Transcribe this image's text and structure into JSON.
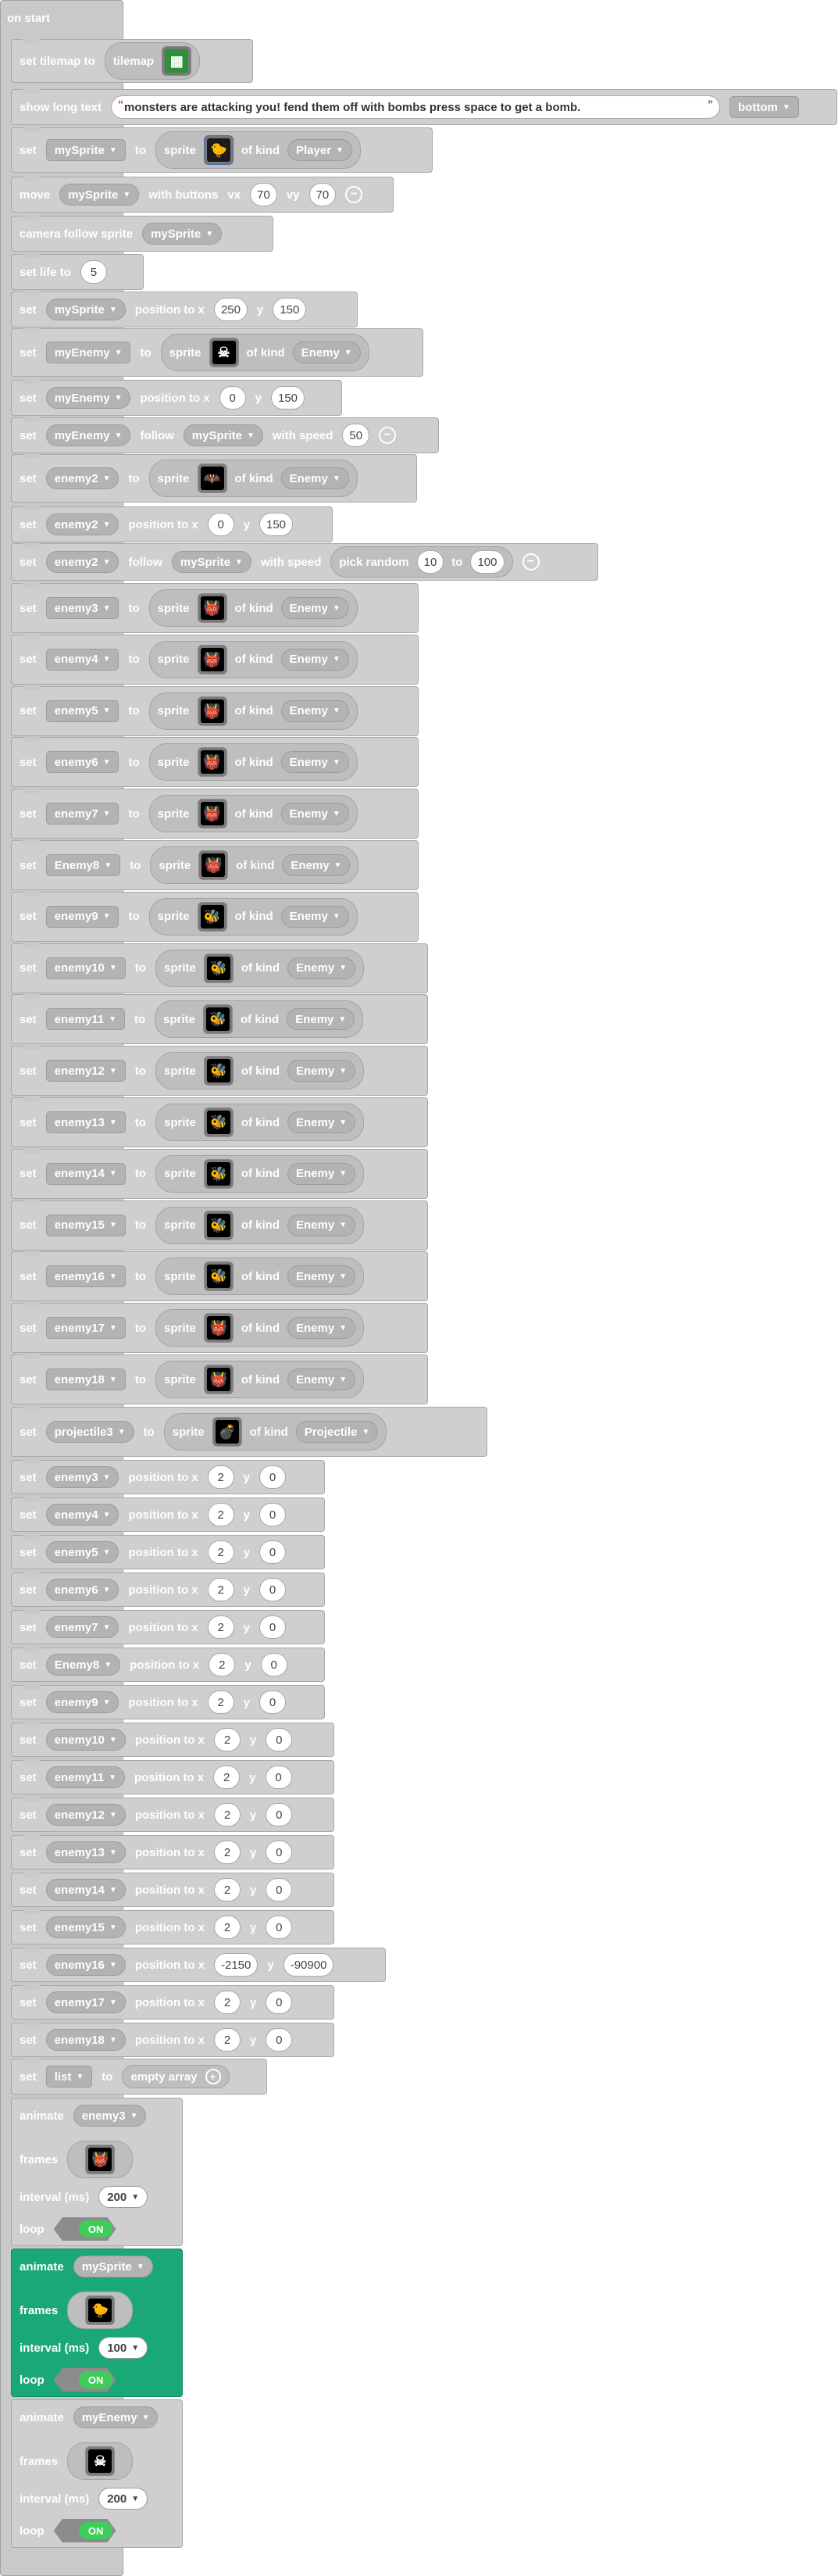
{
  "on_start": "on start",
  "labels": {
    "set": "set",
    "to": "to",
    "sprite": "sprite",
    "of_kind": "of kind",
    "position_to_x": "position to x",
    "y": "y",
    "follow": "follow",
    "with_speed": "with speed",
    "pick_random": "pick random",
    "move": "move",
    "with_buttons": "with buttons",
    "vx": "vx",
    "vy": "vy",
    "camera_follow_sprite": "camera follow sprite",
    "set_life_to": "set life to",
    "set_tilemap_to": "set tilemap to",
    "tilemap": "tilemap",
    "show_long_text": "show long text",
    "empty_array": "empty array",
    "animate": "animate",
    "frames": "frames",
    "interval_ms": "interval (ms)",
    "loop": "loop",
    "on": "ON"
  },
  "long_text": {
    "value": "monsters are attacking you! fend them off with bombs press space to get a bomb.",
    "position": "bottom"
  },
  "player": {
    "var": "mySprite",
    "kind": "Player",
    "vx": "70",
    "vy": "70",
    "camera": "mySprite",
    "life": "5",
    "x": "250",
    "y": "150"
  },
  "my_enemy": {
    "var": "myEnemy",
    "kind": "Enemy",
    "x": "0",
    "y": "150",
    "follow": "mySprite",
    "speed": "50"
  },
  "enemy2": {
    "var": "enemy2",
    "kind": "Enemy",
    "x": "0",
    "y": "150",
    "follow": "mySprite",
    "rand_from": "10",
    "rand_to": "100"
  },
  "enemy_defs": [
    {
      "var": "enemy3",
      "kind": "Enemy",
      "icon": "red-demon-sprite"
    },
    {
      "var": "enemy4",
      "kind": "Enemy",
      "icon": "red-demon-sprite"
    },
    {
      "var": "enemy5",
      "kind": "Enemy",
      "icon": "red-demon-sprite"
    },
    {
      "var": "enemy6",
      "kind": "Enemy",
      "icon": "red-demon-sprite"
    },
    {
      "var": "enemy7",
      "kind": "Enemy",
      "icon": "red-demon-sprite"
    },
    {
      "var": "Enemy8",
      "kind": "Enemy",
      "icon": "red-demon-sprite"
    },
    {
      "var": "enemy9",
      "kind": "Enemy",
      "icon": "yellow-bee-sprite"
    },
    {
      "var": "enemy10",
      "kind": "Enemy",
      "icon": "yellow-bee-sprite"
    },
    {
      "var": "enemy11",
      "kind": "Enemy",
      "icon": "yellow-bee-sprite"
    },
    {
      "var": "enemy12",
      "kind": "Enemy",
      "icon": "yellow-bee-sprite"
    },
    {
      "var": "enemy13",
      "kind": "Enemy",
      "icon": "yellow-bee-sprite"
    },
    {
      "var": "enemy14",
      "kind": "Enemy",
      "icon": "yellow-bee-sprite"
    },
    {
      "var": "enemy15",
      "kind": "Enemy",
      "icon": "yellow-bee-sprite"
    },
    {
      "var": "enemy16",
      "kind": "Enemy",
      "icon": "yellow-bee-sprite"
    },
    {
      "var": "enemy17",
      "kind": "Enemy",
      "icon": "red-demon-sprite"
    },
    {
      "var": "enemy18",
      "kind": "Enemy",
      "icon": "red-demon-sprite"
    }
  ],
  "projectile": {
    "var": "projectile3",
    "kind": "Projectile"
  },
  "positions": [
    {
      "var": "enemy3",
      "x": "2",
      "y": "0"
    },
    {
      "var": "enemy4",
      "x": "2",
      "y": "0"
    },
    {
      "var": "enemy5",
      "x": "2",
      "y": "0"
    },
    {
      "var": "enemy6",
      "x": "2",
      "y": "0"
    },
    {
      "var": "enemy7",
      "x": "2",
      "y": "0"
    },
    {
      "var": "Enemy8",
      "x": "2",
      "y": "0"
    },
    {
      "var": "enemy9",
      "x": "2",
      "y": "0"
    },
    {
      "var": "enemy10",
      "x": "2",
      "y": "0"
    },
    {
      "var": "enemy11",
      "x": "2",
      "y": "0"
    },
    {
      "var": "enemy12",
      "x": "2",
      "y": "0"
    },
    {
      "var": "enemy13",
      "x": "2",
      "y": "0"
    },
    {
      "var": "enemy14",
      "x": "2",
      "y": "0"
    },
    {
      "var": "enemy15",
      "x": "2",
      "y": "0"
    },
    {
      "var": "enemy16",
      "x": "-2150",
      "y": "-90900"
    },
    {
      "var": "enemy17",
      "x": "2",
      "y": "0"
    },
    {
      "var": "enemy18",
      "x": "2",
      "y": "0"
    }
  ],
  "list": {
    "var": "list"
  },
  "animations": [
    {
      "sprite": "enemy3",
      "interval": "200",
      "loop": "ON",
      "active": false,
      "icon": "red-demon-sprite"
    },
    {
      "sprite": "mySprite",
      "interval": "100",
      "loop": "ON",
      "active": true,
      "icon": "yellow-hero-sprite"
    },
    {
      "sprite": "myEnemy",
      "interval": "200",
      "loop": "ON",
      "active": false,
      "icon": "skull-sprite"
    }
  ],
  "colors": {
    "block": "#cfcfcf",
    "active_block": "#1aa876",
    "toggle_on": "#3fcd5a",
    "text_quote": "#c23b3b"
  }
}
